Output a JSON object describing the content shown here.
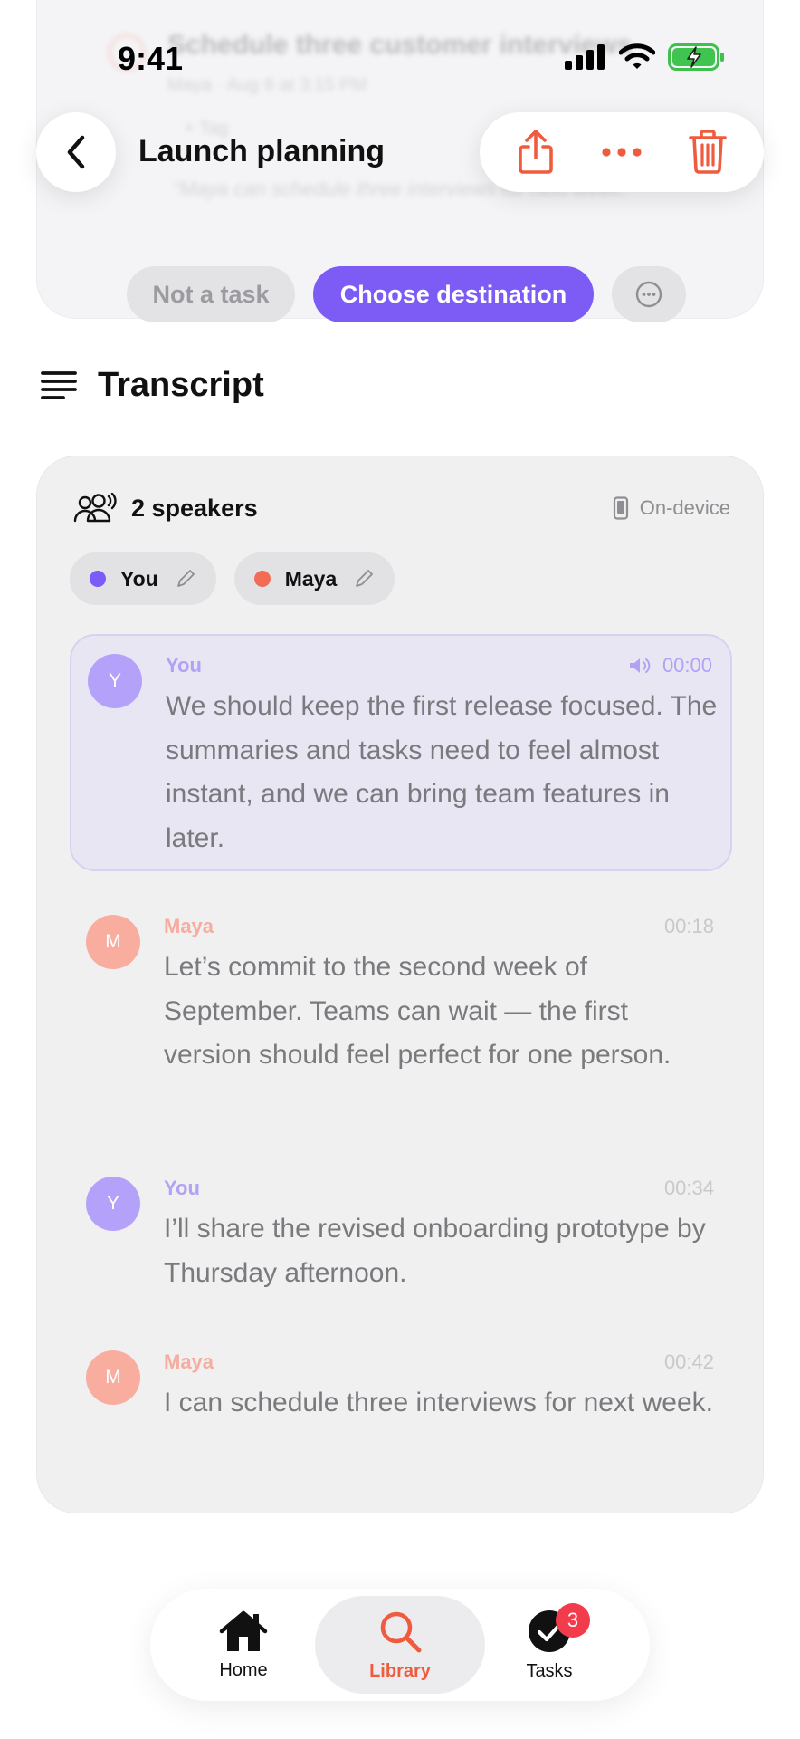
{
  "status_bar": {
    "time": "9:41"
  },
  "header": {
    "title": "Launch planning"
  },
  "task_card": {
    "ghost_title": "Schedule three customer interviews",
    "ghost_meta": "Maya · Aug 8 at 3:15 PM",
    "ghost_tag": "+ Tag",
    "ghost_quote": "“Maya can schedule three interviews for next week.”",
    "not_task_label": "Not a task",
    "choose_label": "Choose destination"
  },
  "transcript": {
    "heading": "Transcript",
    "speakers_count_label": "2 speakers",
    "source_label": "On-device",
    "speakers": [
      {
        "name": "You",
        "color": "#7b5cf6"
      },
      {
        "name": "Maya",
        "color": "#f26b55"
      }
    ],
    "messages": [
      {
        "speaker": "You",
        "initial": "Y",
        "time": "00:00",
        "text": "We should keep the first release focused. The summaries and tasks need to feel almost instant, and we can bring team features in later."
      },
      {
        "speaker": "Maya",
        "initial": "M",
        "time": "00:18",
        "text": "Let’s commit to the second week of September. Teams can wait — the first version should feel perfect for one person."
      },
      {
        "speaker": "You",
        "initial": "Y",
        "time": "00:34",
        "text": "I’ll share the revised onboarding prototype by Thursday afternoon."
      },
      {
        "speaker": "Maya",
        "initial": "M",
        "time": "00:42",
        "text": "I can schedule three interviews for next week."
      }
    ]
  },
  "tabs": [
    {
      "label": "Home",
      "icon": "home-icon"
    },
    {
      "label": "Library",
      "icon": "search-icon"
    },
    {
      "label": "Tasks",
      "icon": "check-circle-icon",
      "badge": "3"
    }
  ],
  "colors": {
    "accent": "#7c5cf5",
    "destructive": "#ef5b3f",
    "you": "#7b5cf6",
    "maya": "#f26b55"
  }
}
